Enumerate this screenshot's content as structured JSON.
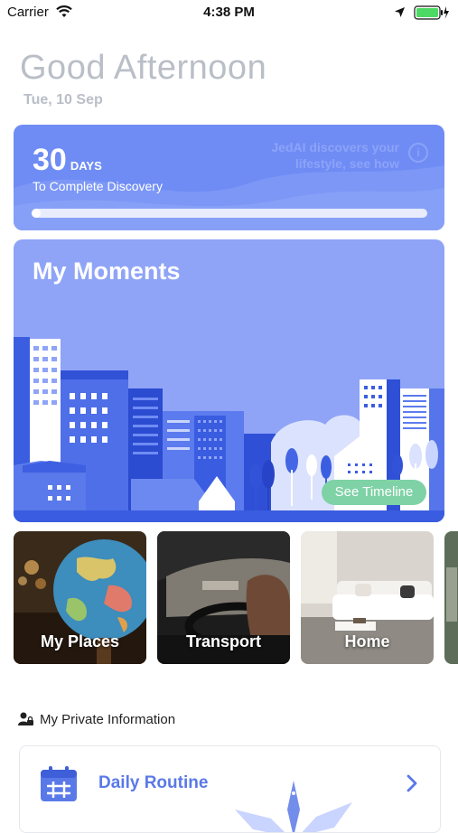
{
  "status_bar": {
    "carrier": "Carrier",
    "time": "4:38 PM"
  },
  "header": {
    "greeting": "Good Afternoon",
    "date": "Tue, 10 Sep"
  },
  "discovery": {
    "days_value": "30",
    "days_unit": "DAYS",
    "subtitle": "To Complete Discovery",
    "note": "JedAI discovers your lifestyle, see how",
    "progress_fraction": 0.01
  },
  "moments": {
    "title": "My Moments",
    "timeline_button": "See Timeline"
  },
  "categories": [
    {
      "label": "My Places"
    },
    {
      "label": "Transport"
    },
    {
      "label": "Home"
    }
  ],
  "private_section": {
    "heading": "My Private Information",
    "items": [
      {
        "label": "Daily Routine"
      }
    ]
  },
  "colors": {
    "accent": "#6f8cf5",
    "card_bg": "#8fa4f7",
    "timeline_button": "#7ed2a6",
    "battery": "#4cd964"
  }
}
